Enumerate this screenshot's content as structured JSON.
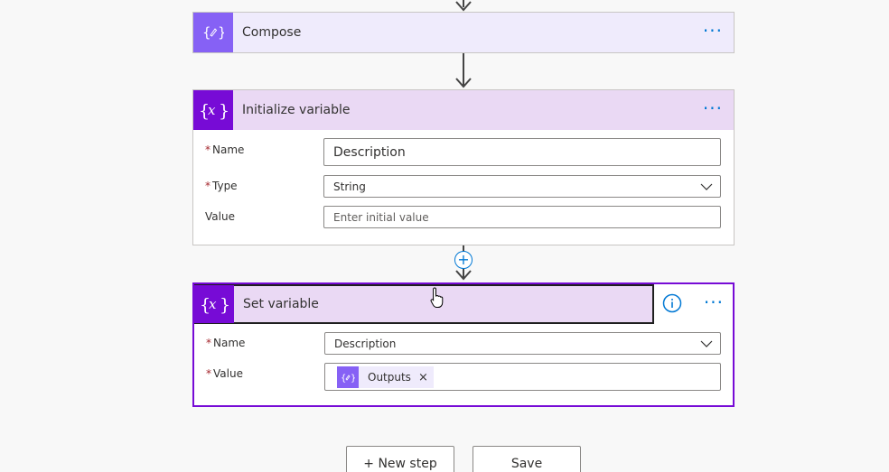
{
  "compose": {
    "title": "Compose"
  },
  "init_variable": {
    "title": "Initialize variable",
    "name_label": "Name",
    "name_value": "Description",
    "type_label": "Type",
    "type_value": "String",
    "value_label": "Value",
    "value_placeholder": "Enter initial value"
  },
  "set_variable": {
    "title": "Set variable",
    "name_label": "Name",
    "name_value": "Description",
    "value_label": "Value",
    "token_label": "Outputs",
    "token_remove": "×"
  },
  "required_mark": "*",
  "more_glyph": "···",
  "plus_glyph": "+",
  "footer": {
    "new_step": "+ New step",
    "save": "Save"
  },
  "icons": {
    "compose": "compose-icon",
    "variable": "variable-icon",
    "info": "info-icon",
    "chevron": "chevron-down-icon"
  },
  "colors": {
    "compose_accent": "#8661f5",
    "variable_accent": "#770bd6",
    "link_blue": "#0078d4",
    "required_red": "#a4262c"
  }
}
